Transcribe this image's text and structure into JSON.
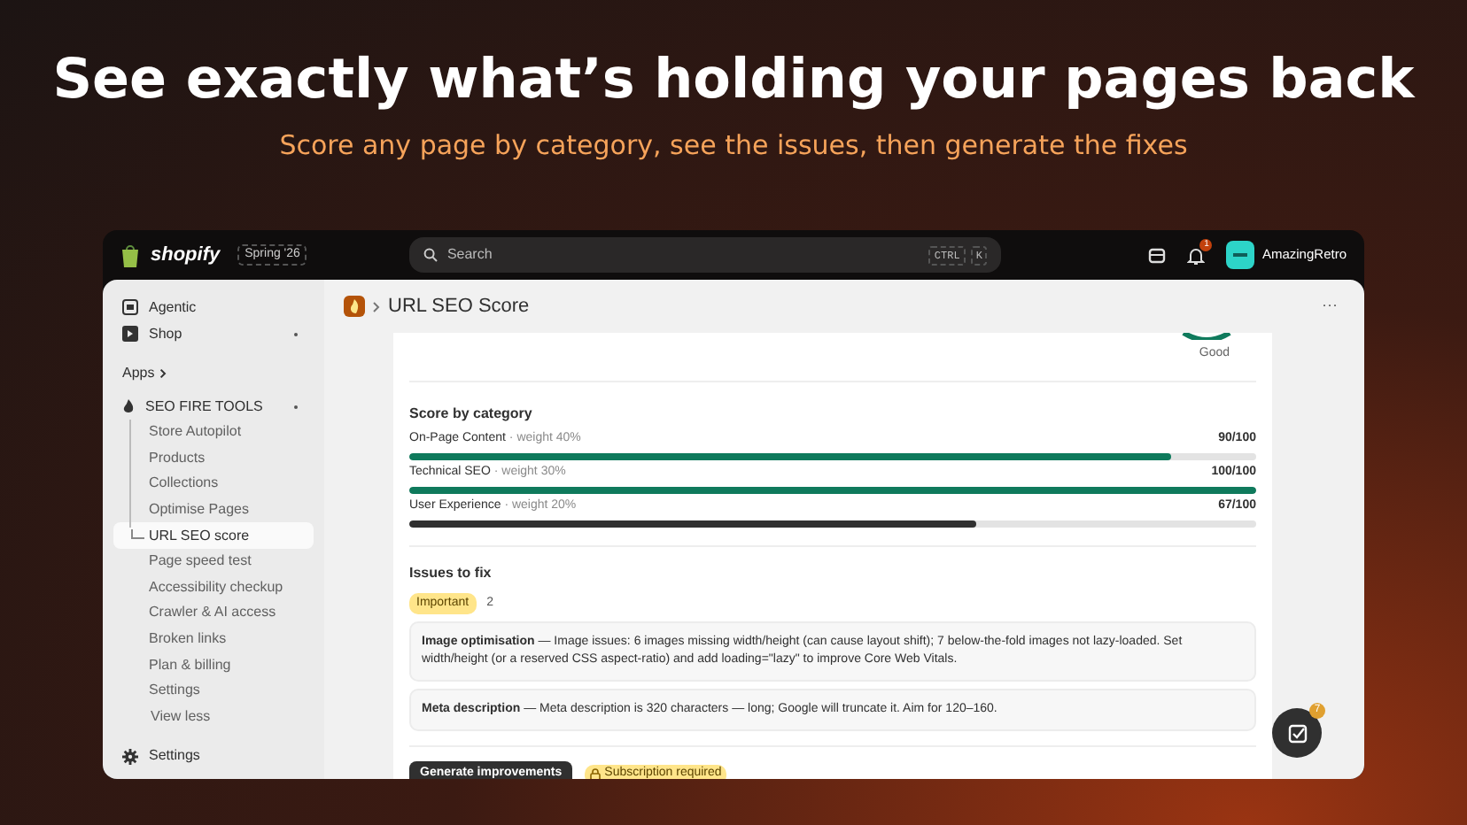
{
  "hero": {
    "title": "See exactly what’s holding your pages back",
    "subtitle": "Score any page by category, see the issues, then generate the fixes"
  },
  "topbar": {
    "logo": "shopify",
    "edition": "Spring '26",
    "search": {
      "placeholder": "Search",
      "shortcut": [
        "CTRL",
        "K"
      ]
    },
    "notifications": "1",
    "store": "AmazingRetro"
  },
  "sidebar": {
    "items": [
      {
        "label": "Agentic",
        "kind": "agent"
      },
      {
        "label": "Shop",
        "kind": "shop"
      }
    ],
    "apps_label": "Apps",
    "app": {
      "label": "SEO FIRE TOOLS",
      "expanded": true,
      "children": [
        {
          "label": "Store Autopilot",
          "selected": false
        },
        {
          "label": "Products",
          "selected": false
        },
        {
          "label": "Collections",
          "selected": false
        },
        {
          "label": "Optimise Pages",
          "selected": false
        },
        {
          "label": "URL SEO score",
          "selected": true
        },
        {
          "label": "Page speed test",
          "selected": false
        },
        {
          "label": "Accessibility checkup",
          "selected": false
        },
        {
          "label": "Crawler & AI access",
          "selected": false
        },
        {
          "label": "Broken links",
          "selected": false
        },
        {
          "label": "Plan & billing",
          "selected": false
        },
        {
          "label": "Settings",
          "selected": false
        }
      ],
      "toggle": "View less"
    },
    "footer": "Settings"
  },
  "page": {
    "title": "URL SEO Score",
    "menu": "···",
    "rating": "Good",
    "categories_title": "Score by category",
    "categories": [
      {
        "name": "On-Page Content",
        "weight": "· weight 40%",
        "score": "90/100",
        "level": 0.9,
        "color": "#0f7a5c"
      },
      {
        "name": "Technical SEO",
        "weight": "· weight 30%",
        "score": "100/100",
        "level": 1.0,
        "color": "#0f7a5c"
      },
      {
        "name": "User Experience",
        "weight": "· weight 20%",
        "score": "67/100",
        "level": 0.67,
        "color": "#303030"
      }
    ],
    "issues_title": "Issues to fix",
    "severity": "Important",
    "count": "2",
    "issues": [
      {
        "text": "**Image optimisation** — Image issues: 6 images missing width/height (can cause layout shift); 7 below-the-fold images not lazy-loaded. Set width/height (or a reserved CSS aspect-ratio) and add loading=\"lazy\" to improve Core Web Vitals."
      },
      {
        "text": "**Meta description** — Meta description is 320 characters — long; Google will truncate it. Aim for 120–160."
      }
    ],
    "generate_button": "Generate improvements",
    "lock_note": "Subscription required"
  },
  "fab": {
    "badge": "7"
  }
}
